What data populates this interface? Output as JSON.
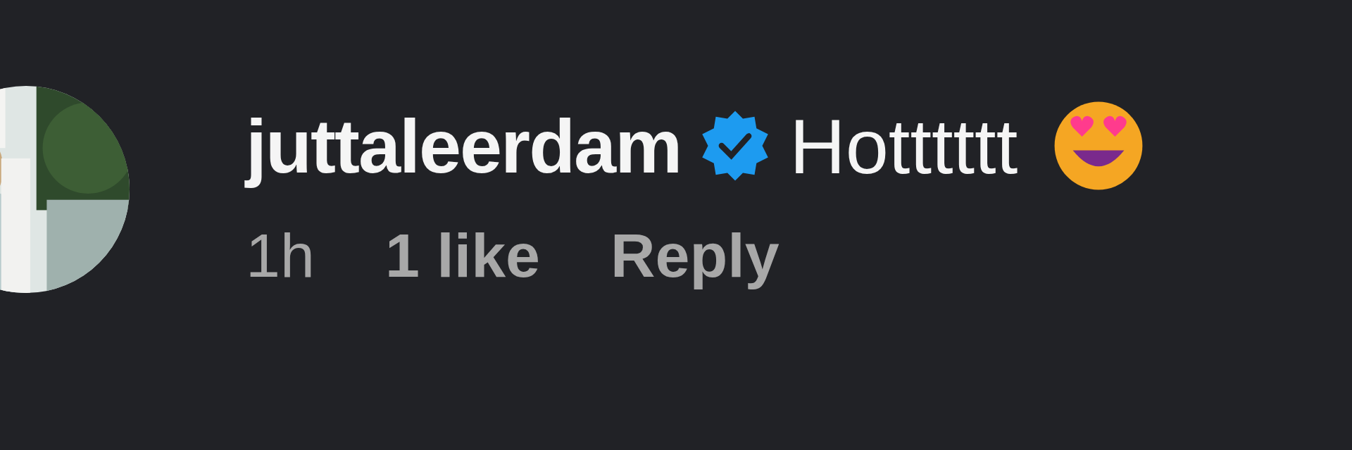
{
  "comment": {
    "username": "juttaleerdam",
    "verified": true,
    "text": "Hotttttt",
    "meta": [
      {
        "kind": "time",
        "label": "1h"
      },
      {
        "kind": "likes",
        "label": "1 like"
      },
      {
        "kind": "reply",
        "label": "Reply"
      }
    ]
  }
}
